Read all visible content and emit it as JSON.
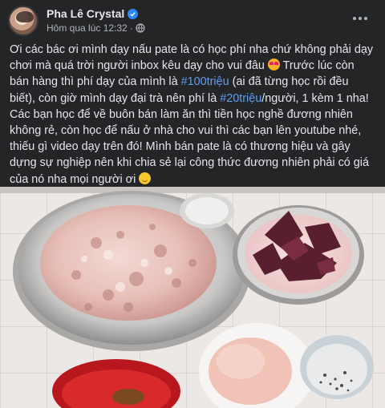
{
  "post": {
    "author": "Pha Lê Crystal",
    "timestamp": "Hôm qua lúc 12:32",
    "separator": "·",
    "lines": [
      [
        {
          "t": "Ơi các bác ơi mình dạy nấu pate là có học phí nha chứ không phải dạy"
        }
      ],
      [
        {
          "t": "chơi mà quá trời người inbox kêu dạy cho vui đâu "
        },
        {
          "emoji": "heart-eyes"
        },
        {
          "t": " Trước lúc còn"
        }
      ],
      [
        {
          "t": "bán hàng thì phí dạy của mình là "
        },
        {
          "tag": "#100triệu"
        },
        {
          "t": " (ai đã từng học rồi đều"
        }
      ],
      [
        {
          "t": "biết), còn giờ mình dạy đại trà nên phí là "
        },
        {
          "tag": "#20triệu"
        },
        {
          "t": "/người, 1 kèm 1 nha!"
        }
      ],
      [
        {
          "t": "Các bạn học để về buôn bán làm ăn thì tiền học nghề đương nhiên"
        }
      ],
      [
        {
          "t": "không rẻ, còn học để nấu ở nhà cho vui thì các bạn lên youtube nhé,"
        }
      ],
      [
        {
          "t": "thiếu gì video dạy trên đó! Mình bán pate là có thương hiệu và gây"
        }
      ],
      [
        {
          "t": "dựng sự nghiệp nên khi chia sẻ lại công thức đương nhiên phải có giá"
        }
      ],
      [
        {
          "t": "của nó nha mọi người ơi "
        },
        {
          "emoji": "smile"
        }
      ]
    ]
  },
  "icons": {
    "verified": "verified-badge-icon",
    "privacy": "globe-icon",
    "more": "more-options-icon"
  },
  "colors": {
    "background": "#242526",
    "text": "#e4e6eb",
    "secondary_text": "#b0b3b8",
    "hashtag": "#5b9ef4",
    "verified": "#2d88ff"
  }
}
